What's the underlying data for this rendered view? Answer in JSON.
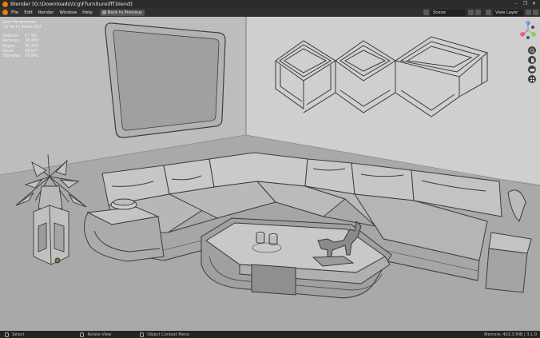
{
  "window": {
    "title": "Blender [G:\\Downloads\\tcg\\Ffurniture\\fff.blend]",
    "controls": [
      "–",
      "❐",
      "✕"
    ]
  },
  "menu": {
    "items": [
      "File",
      "Edit",
      "Render",
      "Window",
      "Help"
    ],
    "back_button": "Back to Previous"
  },
  "header_right": {
    "scene": "Scene",
    "view_layer": "View Layer"
  },
  "viewport": {
    "view_name": "User Perspective",
    "collection": "(3) Part | Plane.013",
    "stats": [
      {
        "key": "Objects",
        "value": "0 / 95"
      },
      {
        "key": "Vertices",
        "value": "38,680"
      },
      {
        "key": "Edges",
        "value": "75,403"
      },
      {
        "key": "Faces",
        "value": "36,877"
      },
      {
        "key": "Triangles",
        "value": "76,842"
      }
    ],
    "gizmo_axes": [
      "X",
      "Y",
      "Z"
    ]
  },
  "statusbar": {
    "select": "Select",
    "rotate": "Rotate View",
    "context": "Object Context Menu",
    "memory": "Memory: 403.3 MiB | 3.1.0"
  },
  "colors": {
    "accent": "#e87d0d",
    "axis_x": "#e8434e",
    "axis_y": "#7fc43f",
    "axis_z": "#4b8fe0"
  }
}
